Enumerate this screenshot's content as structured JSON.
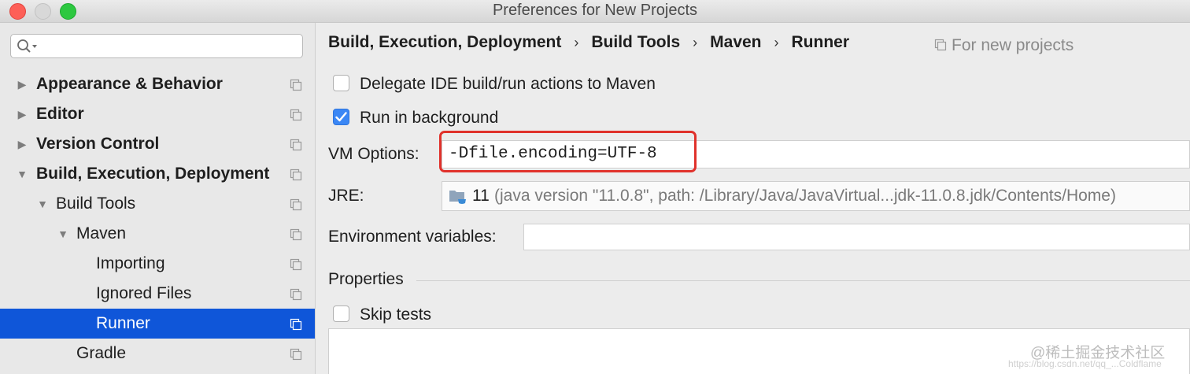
{
  "window": {
    "title": "Preferences for New Projects"
  },
  "sidebar": {
    "search": {
      "value": "",
      "placeholder": ""
    },
    "items": [
      {
        "label": "Appearance & Behavior",
        "level": 0,
        "expanded": false,
        "bold": true,
        "selected": false
      },
      {
        "label": "Editor",
        "level": 0,
        "expanded": false,
        "bold": true,
        "selected": false
      },
      {
        "label": "Version Control",
        "level": 0,
        "expanded": false,
        "bold": true,
        "selected": false
      },
      {
        "label": "Build, Execution, Deployment",
        "level": 0,
        "expanded": true,
        "bold": true,
        "selected": false
      },
      {
        "label": "Build Tools",
        "level": 1,
        "expanded": true,
        "bold": false,
        "selected": false
      },
      {
        "label": "Maven",
        "level": 2,
        "expanded": true,
        "bold": false,
        "selected": false
      },
      {
        "label": "Importing",
        "level": 3,
        "expanded": null,
        "bold": false,
        "selected": false
      },
      {
        "label": "Ignored Files",
        "level": 3,
        "expanded": null,
        "bold": false,
        "selected": false
      },
      {
        "label": "Runner",
        "level": 3,
        "expanded": null,
        "bold": false,
        "selected": true
      },
      {
        "label": "Gradle",
        "level": 2,
        "expanded": null,
        "bold": false,
        "selected": false
      }
    ]
  },
  "breadcrumb": {
    "items": [
      "Build, Execution, Deployment",
      "Build Tools",
      "Maven",
      "Runner"
    ],
    "separator": "›",
    "scope_label": "For new projects"
  },
  "runner": {
    "delegate": {
      "label": "Delegate IDE build/run actions to Maven",
      "checked": false
    },
    "background": {
      "label": "Run in background",
      "checked": true
    },
    "vm_options": {
      "label": "VM Options:",
      "value": "-Dfile.encoding=UTF-8"
    },
    "jre": {
      "label": "JRE:",
      "version": "11",
      "path": "(java version \"11.0.8\", path: /Library/Java/JavaVirtual...jdk-11.0.8.jdk/Contents/Home)"
    },
    "env": {
      "label": "Environment variables:",
      "value": ""
    },
    "properties": {
      "label": "Properties"
    },
    "skip_tests": {
      "label": "Skip tests",
      "checked": false
    }
  },
  "watermark": {
    "text": "@稀土掘金技术社区",
    "url": "https://blog.csdn.net/qq_...Coldflame"
  },
  "colors": {
    "selection": "#0f56d9",
    "highlight_border": "#e0312b",
    "checkbox_checked": "#3b87f5"
  }
}
